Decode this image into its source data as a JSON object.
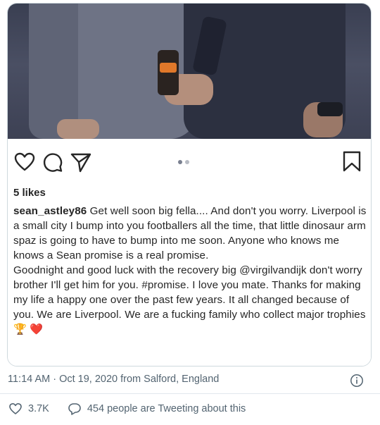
{
  "post": {
    "likes": "5 likes",
    "username": "sean_astley86",
    "caption_first": " Get well soon big fella.... And don't you worry. Liverpool is a small city I bump into you footballers all the time, that little dinosaur arm spaz is going to have to bump into me soon. Anyone who knows me knows a Sean promise is a real promise.",
    "caption_second": "Goodnight and good luck with the recovery big @virgilvandijk don't worry brother I'll get him for you. #promise. I love you mate. Thanks for making my life a happy one over the past few years. It all changed because of you. We are Liverpool. We are a fucking family who collect major trophies",
    "emojis": "🏆 ❤️",
    "icons": [
      "heart-icon",
      "comment-icon",
      "share-icon",
      "bookmark-icon"
    ]
  },
  "tweet": {
    "timestamp": "11:14 AM · Oct 19, 2020 from Salford, England",
    "like_count": "3.7K",
    "conversation": "454 people are Tweeting about this"
  }
}
